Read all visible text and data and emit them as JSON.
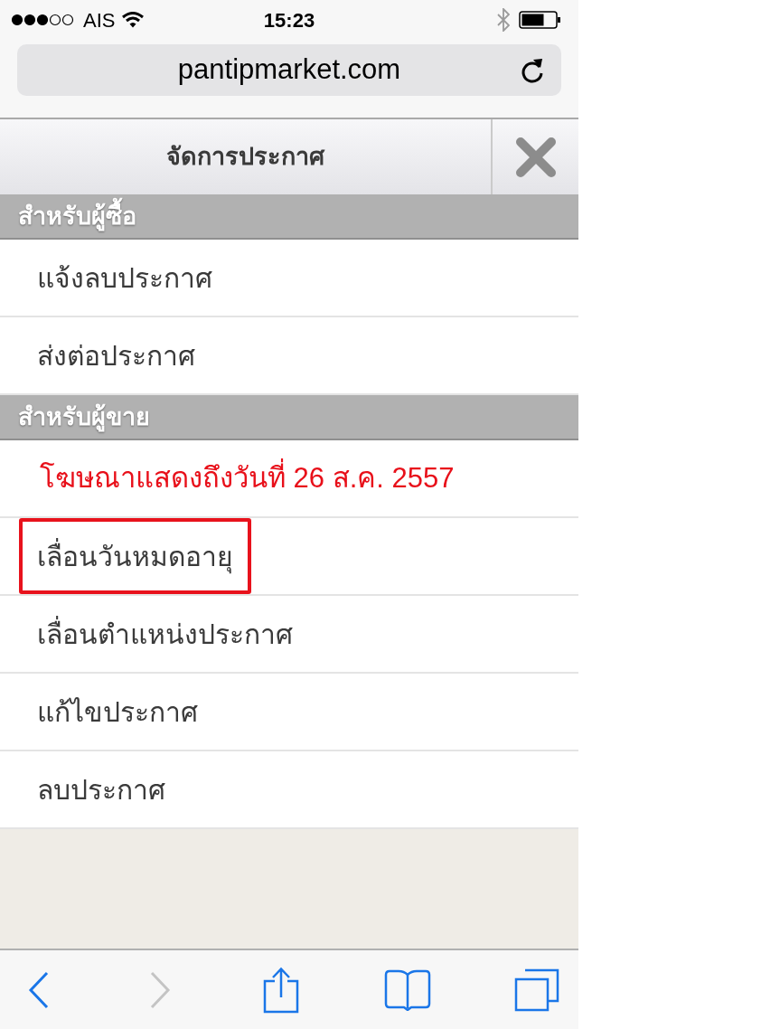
{
  "status_bar": {
    "carrier": "AIS",
    "time": "15:23"
  },
  "address_bar": {
    "url": "pantipmarket.com"
  },
  "header": {
    "title": "จัดการประกาศ"
  },
  "sections": [
    {
      "title": "สำหรับผู้ซื้อ",
      "items": [
        {
          "kind": "action",
          "label": "แจ้งลบประกาศ",
          "highlighted": false
        },
        {
          "kind": "action",
          "label": "ส่งต่อประกาศ",
          "highlighted": false
        }
      ]
    },
    {
      "title": "สำหรับผู้ขาย",
      "items": [
        {
          "kind": "notice",
          "label": "โฆษณาแสดงถึงวันที่ 26 ส.ค. 2557",
          "highlighted": false
        },
        {
          "kind": "action",
          "label": "เลื่อนวันหมดอายุ",
          "highlighted": true
        },
        {
          "kind": "action",
          "label": "เลื่อนตำแหน่งประกาศ",
          "highlighted": false
        },
        {
          "kind": "action",
          "label": "แก้ไขประกาศ",
          "highlighted": false
        },
        {
          "kind": "action",
          "label": "ลบประกาศ",
          "highlighted": false
        }
      ]
    }
  ],
  "toolbar": [
    {
      "kind": "back",
      "disabled": false
    },
    {
      "kind": "forward",
      "disabled": true
    },
    {
      "kind": "share",
      "disabled": false
    },
    {
      "kind": "bookmarks",
      "disabled": false
    },
    {
      "kind": "tabs",
      "disabled": false
    }
  ]
}
